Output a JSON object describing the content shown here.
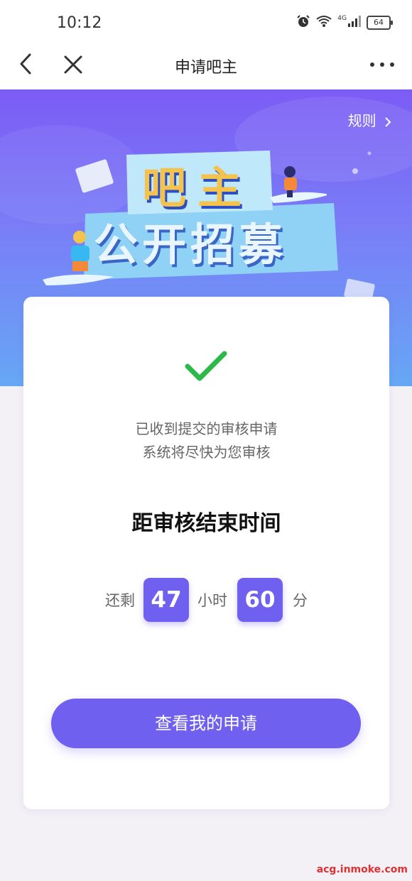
{
  "status_bar": {
    "time": "10:12",
    "network": "4G",
    "battery": "64"
  },
  "nav": {
    "title": "申请吧主",
    "back_icon": "chevron-left-icon",
    "close_icon": "close-icon",
    "more_icon": "more-icon"
  },
  "hero": {
    "rules_label": "规则",
    "banner_line1": "吧主",
    "banner_line2": "公开招募"
  },
  "card": {
    "message_line1": "已收到提交的审核申请",
    "message_line2": "系统将尽快为您审核",
    "countdown_title": "距审核结束时间",
    "remaining_label": "还剩",
    "hours_value": "47",
    "hours_unit": "小时",
    "minutes_value": "60",
    "minutes_unit": "分",
    "view_button": "查看我的申请"
  },
  "watermark": "acg.inmoke.com",
  "colors": {
    "accent": "#7060f0",
    "success": "#2db84a"
  }
}
